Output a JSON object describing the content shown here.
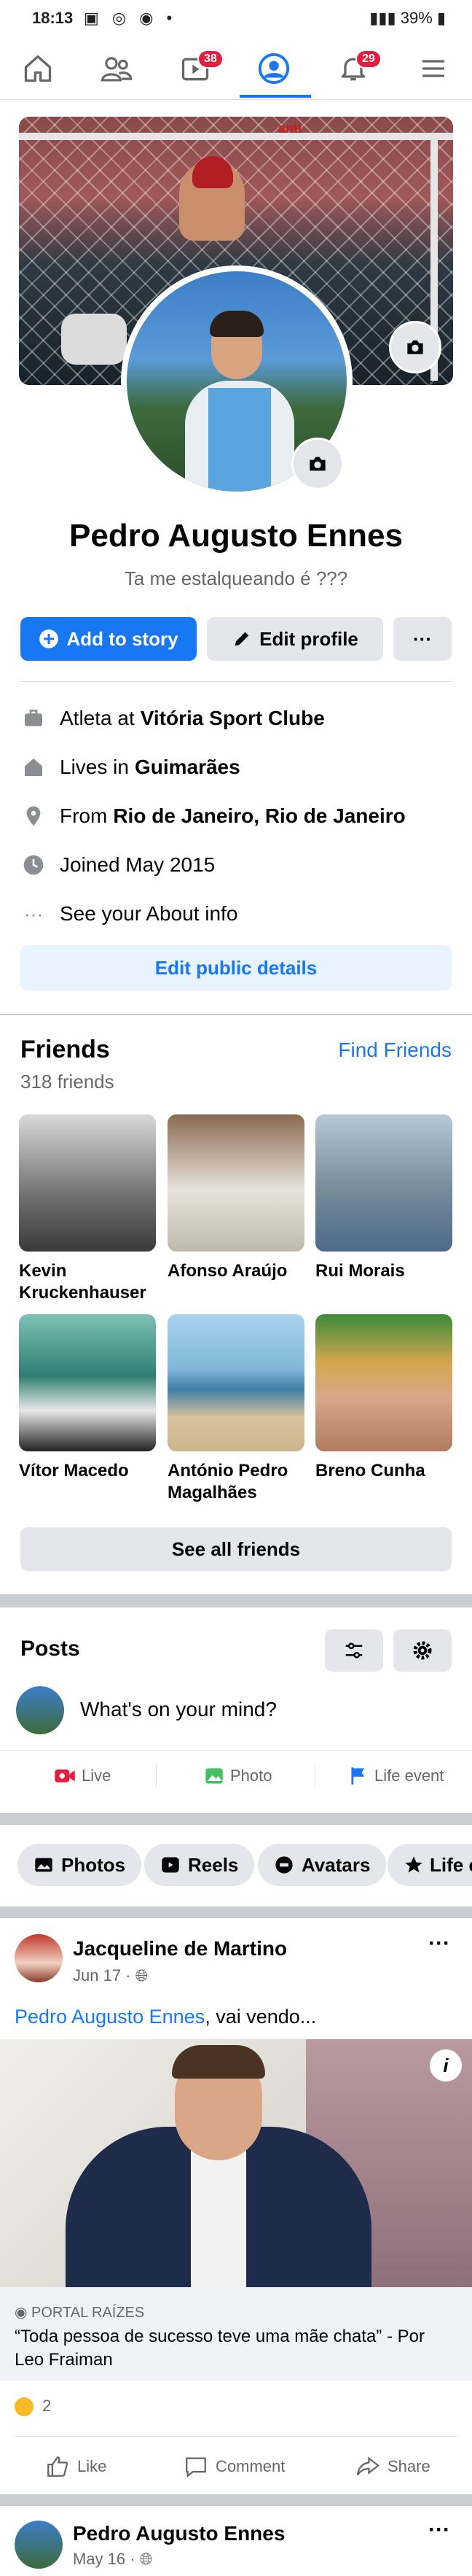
{
  "status_bar": {
    "time": "18:13",
    "battery": "39%"
  },
  "nav": {
    "watch_badge": "38",
    "notifications_badge": "29"
  },
  "cover": {
    "sign_text": "anti"
  },
  "profile": {
    "name": "Pedro Augusto Ennes",
    "bio": "Ta me estalqueando é ???",
    "add_story_label": "Add to story",
    "edit_profile_label": "Edit profile",
    "more_label": "···"
  },
  "details": {
    "work_prefix": "Atleta at",
    "work_value": "Vitória Sport Clube",
    "lives_prefix": "Lives in",
    "lives_value": "Guimarães",
    "from_prefix": "From",
    "from_value": "Rio de Janeiro, Rio de Janeiro",
    "joined": "Joined May 2015",
    "about": "See your About info",
    "edit_public": "Edit public details"
  },
  "friends": {
    "title": "Friends",
    "count": "318 friends",
    "find": "Find Friends",
    "see_all": "See all friends",
    "items": [
      {
        "name": "Kevin Kruckenhauser"
      },
      {
        "name": "Afonso Araújo"
      },
      {
        "name": "Rui Morais"
      },
      {
        "name": "Vítor Macedo"
      },
      {
        "name": "António Pedro Magalhães"
      },
      {
        "name": "Breno Cunha"
      }
    ]
  },
  "posts": {
    "title": "Posts",
    "composer_placeholder": "What's on your mind?",
    "live": "Live",
    "photo": "Photo",
    "life_event": "Life event",
    "chips": [
      "Photos",
      "Reels",
      "Avatars",
      "Life e"
    ]
  },
  "post1": {
    "author": "Jacqueline de Martino",
    "date": "Jun 17 ·",
    "text_link": "Pedro Augusto Ennes",
    "text_rest": ", vai vendo...",
    "source": "PORTAL RAÍZES",
    "headline": "“Toda pessoa de sucesso teve uma mãe chata” - Por Leo Fraiman",
    "reactions": "2",
    "like": "Like",
    "comment": "Comment",
    "share": "Share"
  },
  "post2": {
    "author": "Pedro Augusto Ennes",
    "date": "May 16 ·"
  },
  "colors": {
    "accent": "#1877f2",
    "badge": "#e41e3f"
  }
}
